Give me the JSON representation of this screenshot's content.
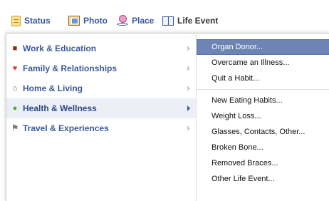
{
  "composer": {
    "tabs": [
      {
        "label": "Status",
        "icon": "status-icon"
      },
      {
        "label": "Photo",
        "icon": "photo-icon"
      },
      {
        "label": "Place",
        "icon": "place-icon"
      },
      {
        "label": "Life Event",
        "icon": "life-event-icon"
      }
    ]
  },
  "categories": [
    {
      "label": "Work & Education",
      "icon": "briefcase-icon"
    },
    {
      "label": "Family & Relationships",
      "icon": "heart-icon"
    },
    {
      "label": "Home & Living",
      "icon": "house-icon"
    },
    {
      "label": "Health & Wellness",
      "icon": "apple-icon"
    },
    {
      "label": "Travel & Experiences",
      "icon": "flag-icon"
    }
  ],
  "submenu": {
    "group1": [
      "Organ Donor...",
      "Overcame an Illness...",
      "Quit a Habit..."
    ],
    "group2": [
      "New Eating Habits...",
      "Weight Loss...",
      "Glasses, Contacts, Other...",
      "Broken Bone...",
      "Removed Braces...",
      "Other Life Event..."
    ]
  },
  "colors": {
    "link_blue": "#3b5998",
    "highlight": "#6d84b4",
    "selected_bg": "#eceff5"
  }
}
